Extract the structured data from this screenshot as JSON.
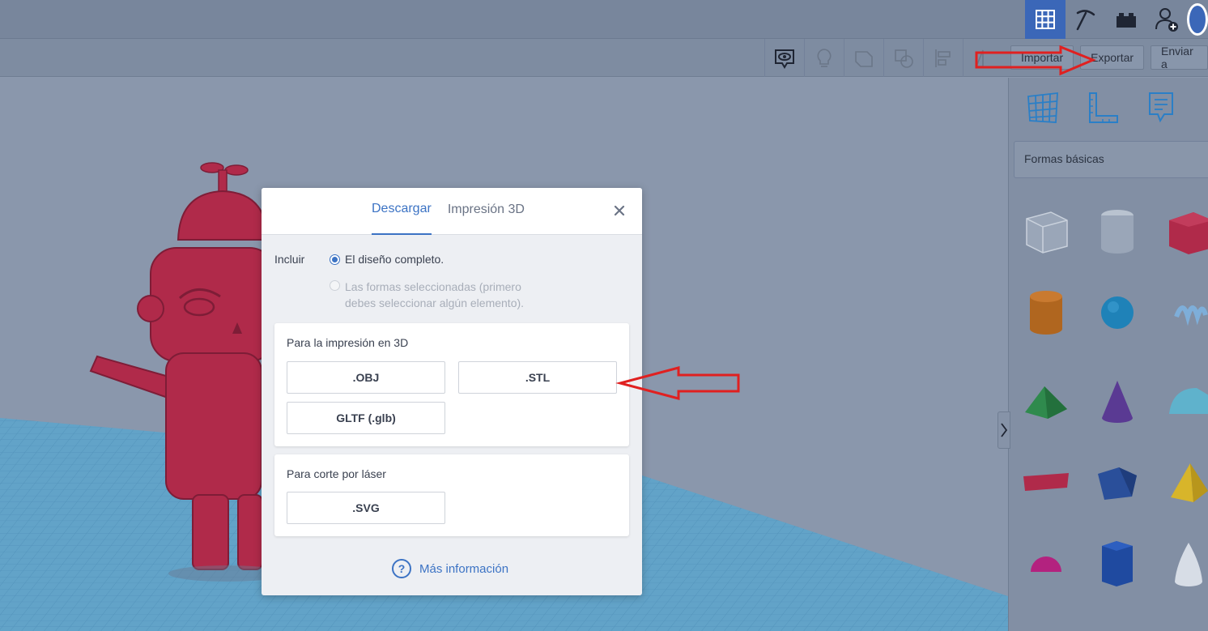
{
  "toolbar": {
    "import_label": "Importar",
    "export_label": "Exportar",
    "send_label": "Enviar a"
  },
  "panel": {
    "shape_category": "Formas básicas"
  },
  "modal": {
    "tabs": [
      "Descargar",
      "Impresión 3D"
    ],
    "include_label": "Incluir",
    "option_full": "El diseño completo.",
    "option_selected_line1": "Las formas seleccionadas (primero",
    "option_selected_line2": "debes seleccionar algún elemento).",
    "section_3d": {
      "title": "Para la impresión en 3D",
      "buttons": [
        ".OBJ",
        ".STL",
        "GLTF (.glb)"
      ]
    },
    "section_laser": {
      "title": "Para corte por láser",
      "buttons": [
        ".SVG"
      ]
    },
    "more_info": "Más información",
    "help_glyph": "?",
    "close_glyph": "×"
  },
  "colors": {
    "accent": "#3c73c4",
    "robot": "#b02a4a",
    "grid": "#3a98c9",
    "annotation_arrow": "#e02020"
  }
}
